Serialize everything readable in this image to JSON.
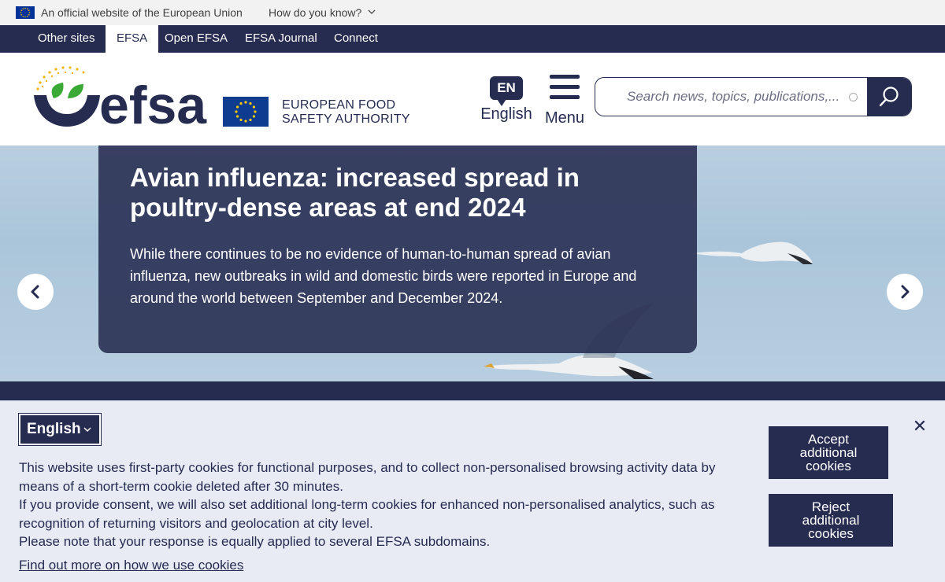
{
  "eu_banner": {
    "official_text": "An official website of the European Union",
    "how_text": "How do you know?"
  },
  "site_nav": {
    "items": [
      "Other sites",
      "EFSA",
      "Open EFSA",
      "EFSA Journal",
      "Connect"
    ],
    "active": "EFSA"
  },
  "header": {
    "logo_text": "efsa",
    "agency_line1": "EUROPEAN FOOD",
    "agency_line2": "SAFETY AUTHORITY",
    "lang_code": "EN",
    "lang_label": "English",
    "menu_label": "Menu",
    "search_placeholder": "Search news, topics, publications,..."
  },
  "hero": {
    "title": "Avian influenza: increased spread in poultry-dense areas at end 2024",
    "text": "While there continues to be no evidence of human-to-human spread of avian influenza, new outbreaks in wild and domestic birds were reported in Europe and around the world between September and December 2024."
  },
  "cookie_banner": {
    "language": "English",
    "paragraphs": [
      "This website uses first-party cookies for functional purposes, and to collect non-personalised browsing activity data by means of a short-term cookie deleted after 30 minutes.",
      "If you provide consent, we will also set additional long-term cookies for enhanced non-personalised analytics, such as recognition of returning visitors and geolocation at city level.",
      "Please note that your response is equally applied to several EFSA subdomains."
    ],
    "link_text": "Find out more on how we use cookies",
    "accept_label": "Accept additional cookies",
    "reject_label": "Reject additional cookies",
    "close_glyph": "✕"
  },
  "colors": {
    "navy": "#262b50",
    "eu_blue": "#003399",
    "logo_green": "#3aa935",
    "logo_gold": "#f0b400",
    "cookie_bg": "#e8ebf4"
  }
}
